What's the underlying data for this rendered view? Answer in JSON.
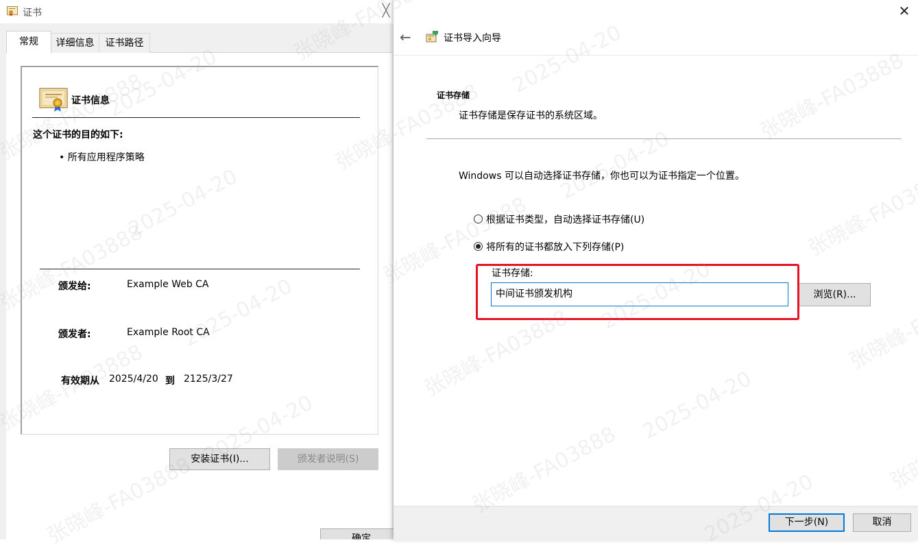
{
  "left_window": {
    "title": "证书",
    "close_glyph": "╳",
    "tabs": [
      {
        "label": "常规"
      },
      {
        "label": "详细信息"
      },
      {
        "label": "证书路径"
      }
    ],
    "cert_info_heading": "证书信息",
    "purpose_heading": "这个证书的目的如下:",
    "purpose_item": "• 所有应用程序策略",
    "issued_to_label": "颁发给:",
    "issued_to_value": "Example Web CA",
    "issued_by_label": "颁发者:",
    "issued_by_value": "Example Root CA",
    "valid_from_label": "有效期从",
    "valid_from": "2025/4/20",
    "valid_to_label": "到",
    "valid_to": "2125/3/27",
    "install_button": "安装证书(I)...",
    "issuer_statement_button": "颁发者说明(S)",
    "ok_button": "确定"
  },
  "right_window": {
    "close_glyph": "✕",
    "back_glyph": "←",
    "wizard_title": "证书导入向导",
    "store_heading": "证书存储",
    "store_desc": "证书存储是保存证书的系统区域。",
    "windows_text": "Windows 可以自动选择证书存储，你也可以为证书指定一个位置。",
    "radio_auto_label": "根据证书类型，自动选择证书存储(U)",
    "radio_manual_label": "将所有的证书都放入下列存储(P)",
    "radio_selected": "manual",
    "cert_store_label": "证书存储:",
    "cert_store_value": "中间证书颁发机构",
    "browse_button": "浏览(R)...",
    "next_button": "下一步(N)",
    "cancel_button": "取消"
  },
  "watermark": {
    "name_text": "张晓峰-FA03888",
    "date_text": "2025-04-20"
  },
  "colors": {
    "highlight": "#e81123",
    "focus_blue": "#0078d7"
  }
}
